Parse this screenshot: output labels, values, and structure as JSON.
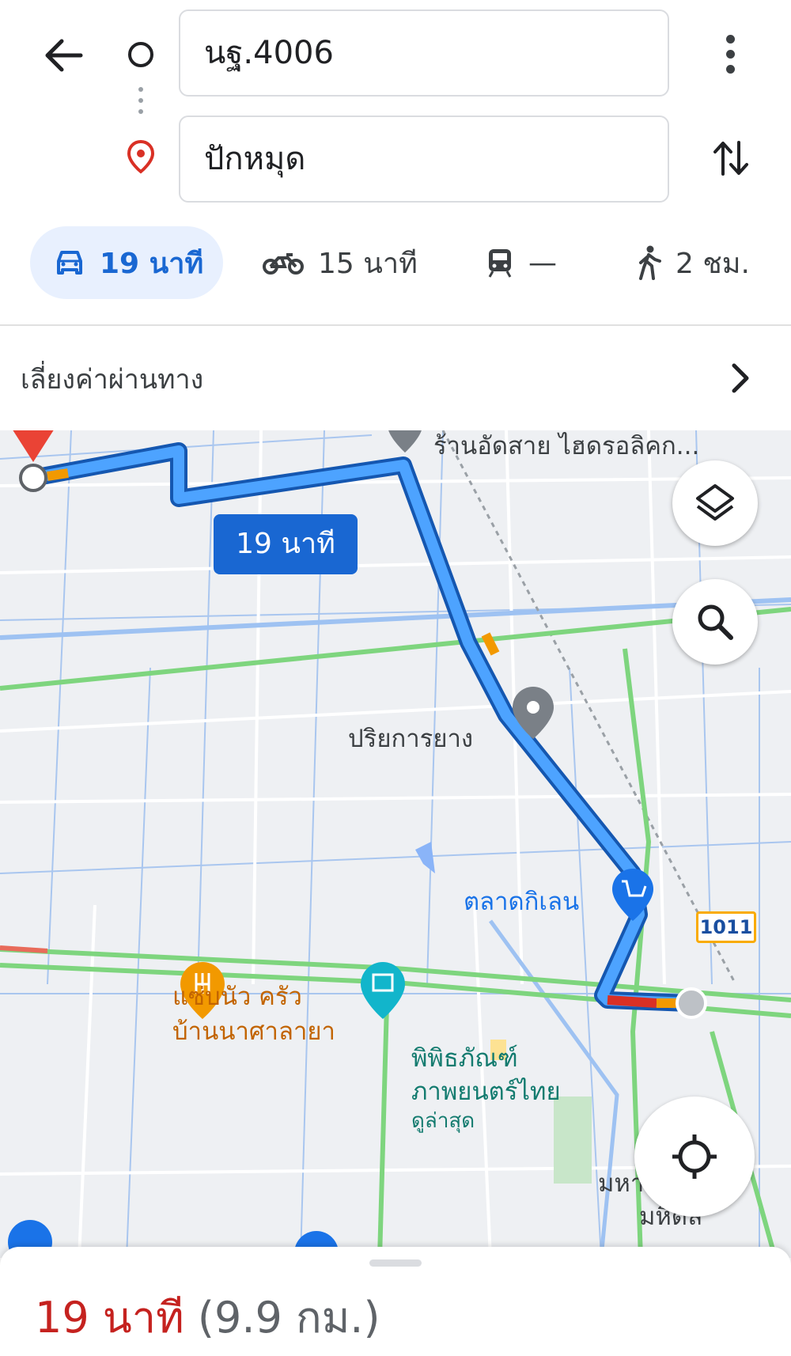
{
  "search": {
    "origin": "นฐ.4006",
    "destination": "ปักหมุด"
  },
  "modes": {
    "drive": "19 นาที",
    "motorcycle": "15 นาที",
    "transit": "—",
    "walk": "2 ชม."
  },
  "toll_option": "เลี่ยงค่าผ่านทาง",
  "map": {
    "route_eta_chip": "19 นาที",
    "labels": {
      "shop_top": "ร้านอัดสาย ไฮดรอลิคก...",
      "tire": "ปริยการยาง",
      "market": "ตลาดกิเลน",
      "route_number": "1011",
      "restaurant_line1": "แซ่บนัว ครัว",
      "restaurant_line2": "บ้านนาศาลายา",
      "museum_line1": "พิพิธภัณฑ์",
      "museum_line2": "ภาพยนตร์ไทย",
      "museum_sub": "ดูล่าสุด",
      "university_line1": "มหาวิทยาลัย",
      "university_line2": "มหิดล"
    }
  },
  "sheet": {
    "time": "19 นาที",
    "distance": "(9.9 กม.)"
  },
  "colors": {
    "route": "#1a73e8",
    "active_mode_bg": "#e8f0fe",
    "eta_red": "#c5221f",
    "traffic_green": "#7ed57e"
  }
}
